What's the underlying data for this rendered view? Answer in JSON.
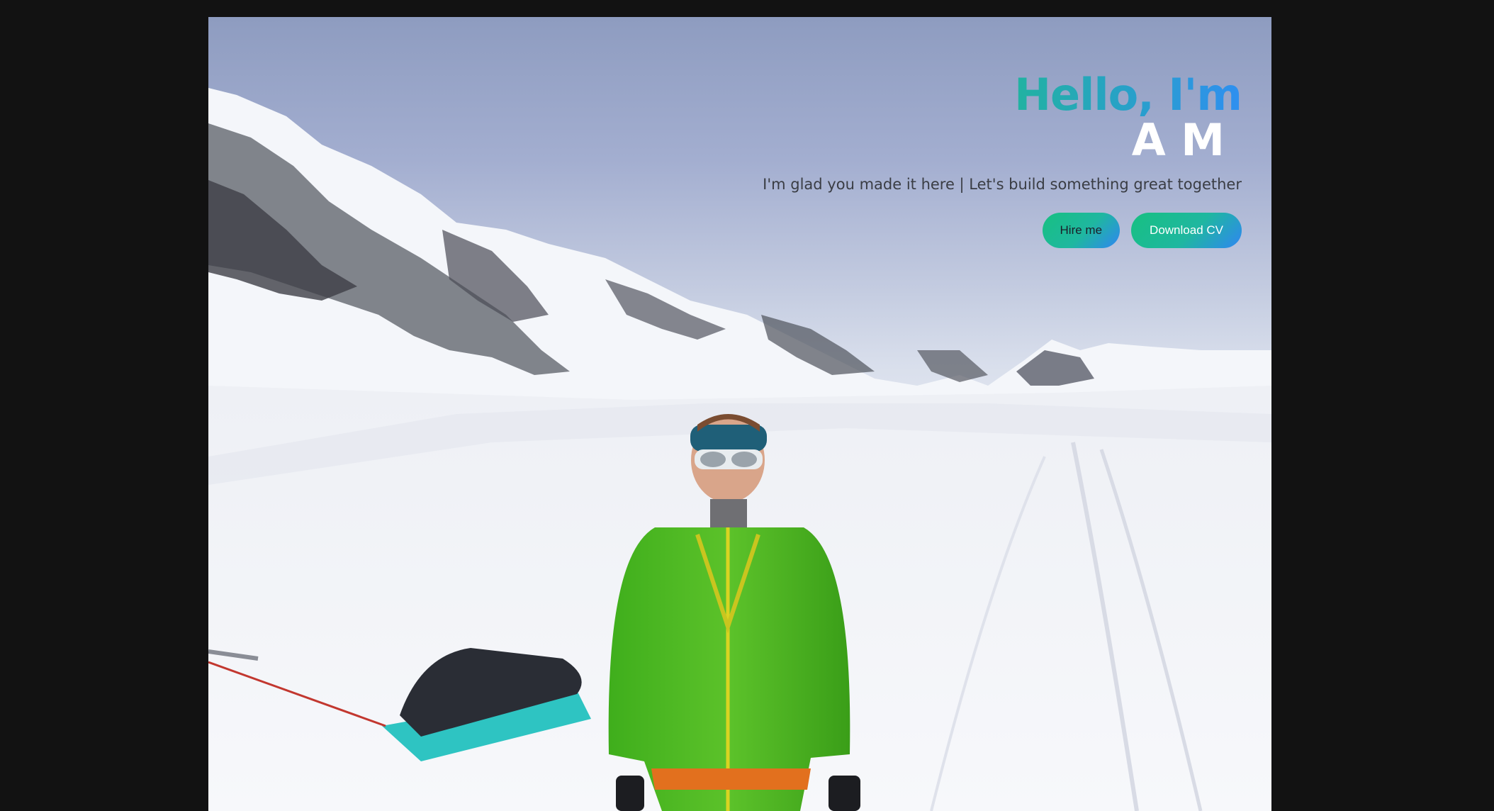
{
  "hero": {
    "greeting": "Hello, I'm",
    "name": "A M",
    "tagline": "I'm glad you made it here | Let's build something great together",
    "hire_label": "Hire me",
    "cv_label": "Download CV"
  },
  "colors": {
    "page_background": "#121212",
    "accent_green": "#14c473",
    "accent_blue": "#2f8ff0"
  },
  "background_image": "snowy-mountain-glacier-hiker-photo"
}
